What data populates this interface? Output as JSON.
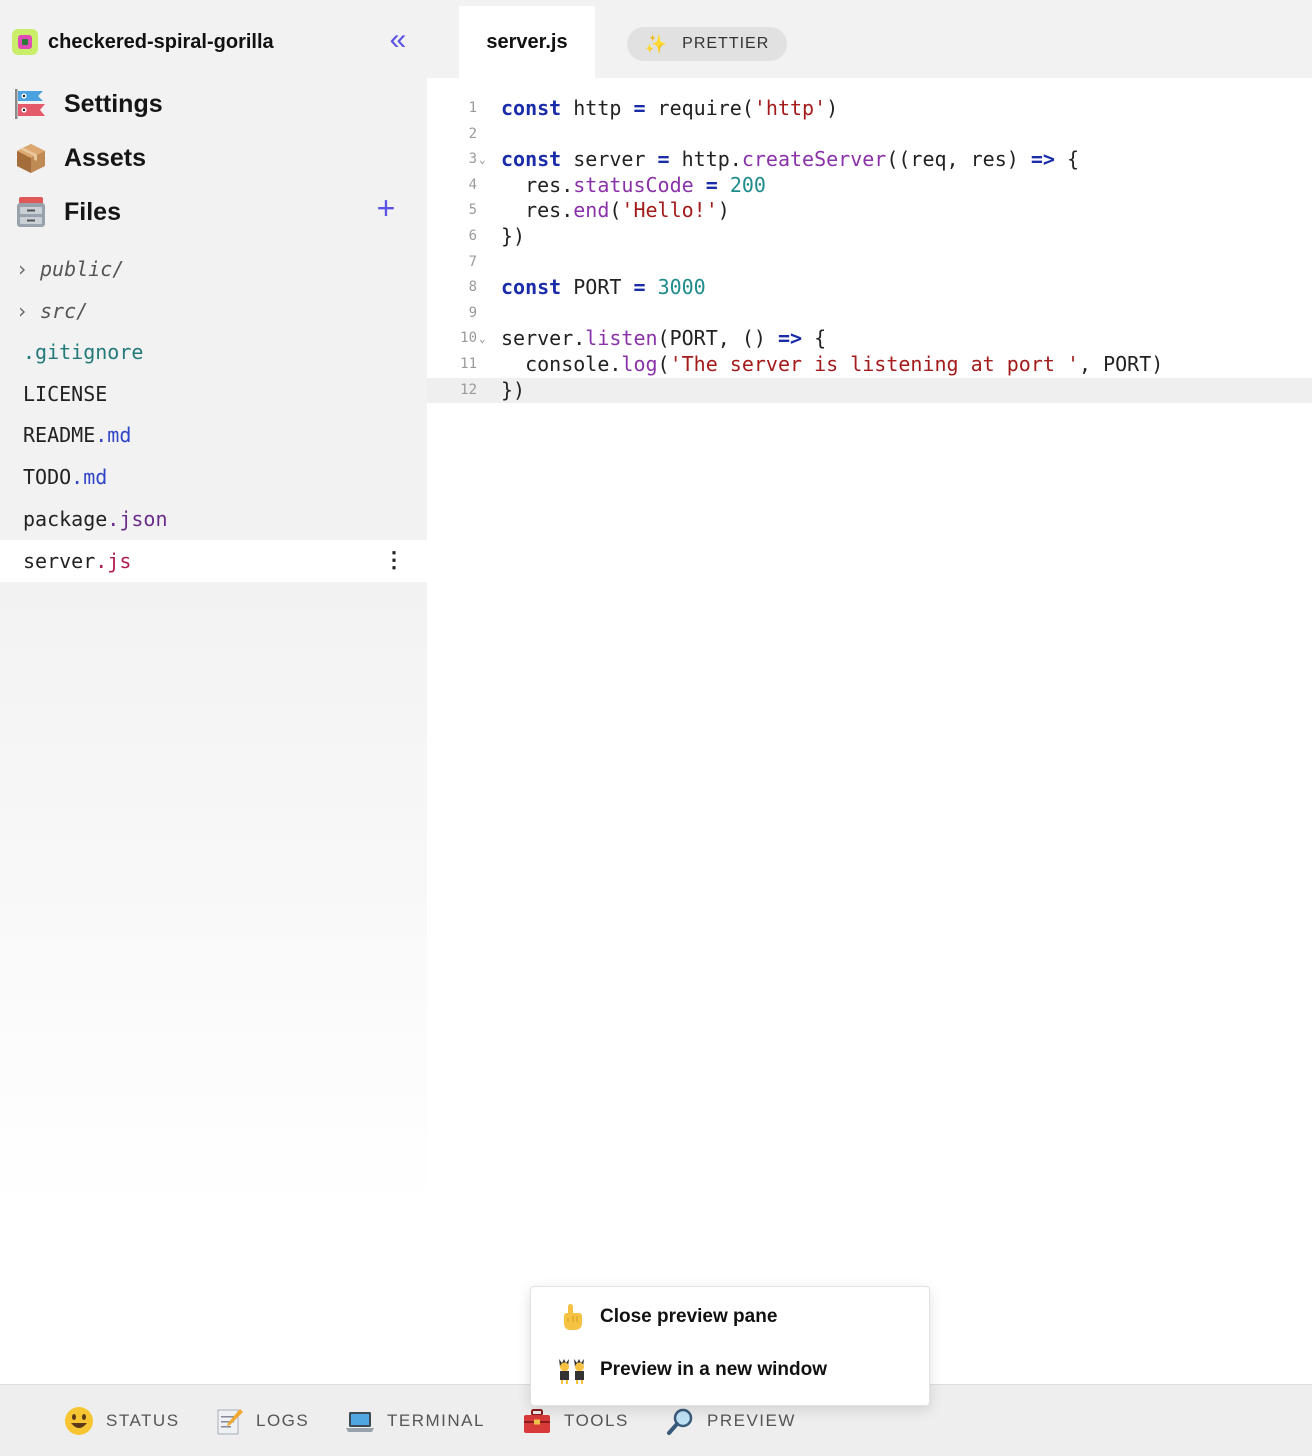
{
  "project": {
    "name": "checkered-spiral-gorilla",
    "collapse_label": "«"
  },
  "nav": [
    {
      "label": "Settings",
      "icon": "carp-streamer-icon"
    },
    {
      "label": "Assets",
      "icon": "package-icon"
    },
    {
      "label": "Files",
      "icon": "file-cabinet-icon"
    }
  ],
  "files_add_label": "+",
  "files": [
    {
      "type": "folder",
      "name": "public/",
      "chevron": "›"
    },
    {
      "type": "folder",
      "name": "src/",
      "chevron": "›"
    },
    {
      "type": "file",
      "base": "",
      "ext": ".gitignore"
    },
    {
      "type": "file",
      "base": "LICENSE",
      "ext": ""
    },
    {
      "type": "file",
      "base": "README",
      "ext": ".md"
    },
    {
      "type": "file",
      "base": "TODO",
      "ext": ".md"
    },
    {
      "type": "file",
      "base": "package",
      "ext": ".json"
    },
    {
      "type": "file",
      "base": "server",
      "ext": ".js",
      "active": true,
      "menu": "⋮"
    }
  ],
  "editor": {
    "tab_label": "server.js",
    "prettier_label": "PRETTIER",
    "sparkle": "✨",
    "fold_marker": "⌄",
    "line_numbers": [
      "1",
      "2",
      "3",
      "4",
      "5",
      "6",
      "7",
      "8",
      "9",
      "10",
      "11",
      "12"
    ]
  },
  "bottom_bar": [
    {
      "label": "STATUS",
      "icon": "smiley-icon"
    },
    {
      "label": "LOGS",
      "icon": "memo-icon"
    },
    {
      "label": "TERMINAL",
      "icon": "laptop-icon"
    },
    {
      "label": "TOOLS",
      "icon": "toolbox-icon"
    },
    {
      "label": "PREVIEW",
      "icon": "magnifier-icon"
    }
  ],
  "popup": [
    {
      "label": "Close preview pane",
      "icon": "pointing-up-icon"
    },
    {
      "label": "Preview in a new window",
      "icon": "twins-icon"
    }
  ],
  "colors": {
    "accent": "#5b53e6",
    "sidebar_bg": "#f2f2f2",
    "keyword": "#1a2ca8",
    "string": "#a31b1b",
    "number": "#1f8c8c",
    "property": "#8a32a8"
  }
}
